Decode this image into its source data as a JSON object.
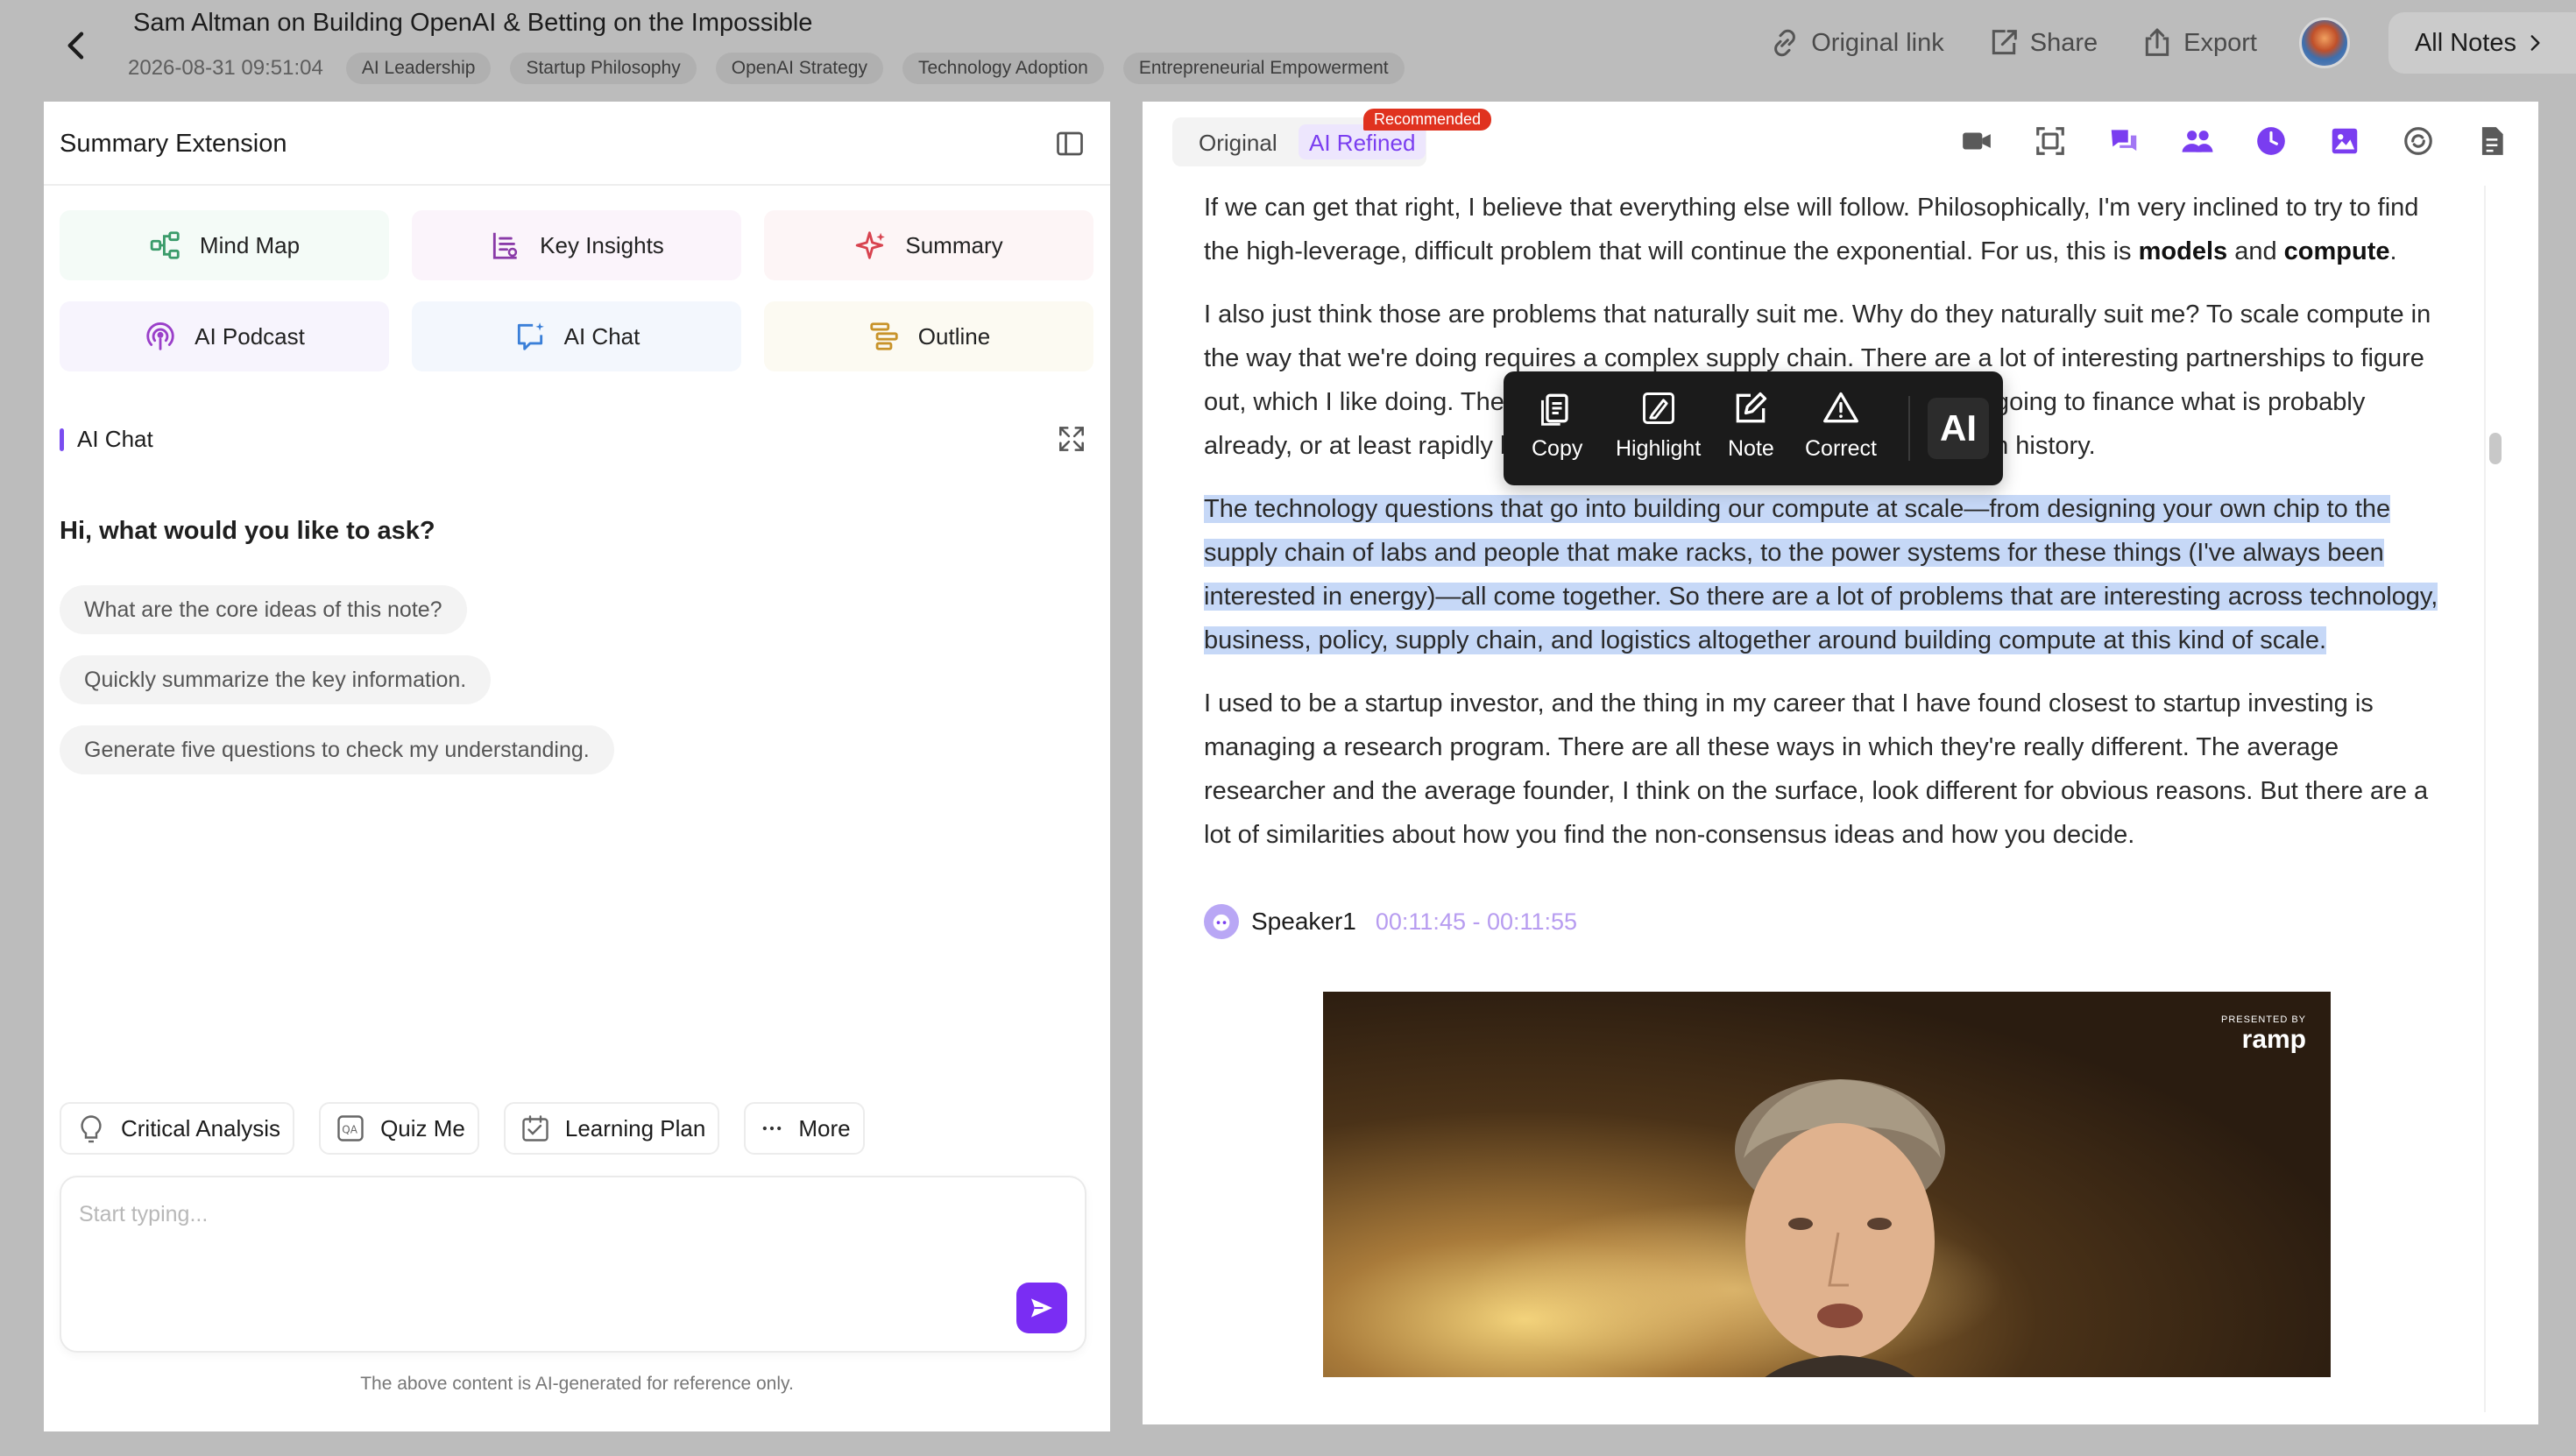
{
  "header": {
    "title": "Sam Altman on Building OpenAI & Betting on the Impossible",
    "date": "2026-08-31 09:51:04",
    "tags": [
      "AI Leadership",
      "Startup Philosophy",
      "OpenAI Strategy",
      "Technology Adoption",
      "Entrepreneurial Empowerment"
    ],
    "actions": {
      "original_link": "Original link",
      "share": "Share",
      "export": "Export",
      "all_notes": "All Notes"
    }
  },
  "left_panel": {
    "title": "Summary Extension",
    "features": [
      "Mind Map",
      "Key Insights",
      "Summary",
      "AI Podcast",
      "AI Chat",
      "Outline"
    ],
    "chat": {
      "section_label": "AI Chat",
      "greeting": "Hi, what would you like to ask?",
      "suggestions": [
        "What are the core ideas of this note?",
        "Quickly summarize the key information.",
        "Generate five questions to check my understanding."
      ],
      "quick_actions": [
        "Critical Analysis",
        "Quiz Me",
        "Learning Plan",
        "More"
      ],
      "input_placeholder": "Start typing...",
      "disclaimer": "The above content is AI-generated for reference only."
    }
  },
  "right_panel": {
    "tabs": {
      "original": "Original",
      "ai_refined": "AI Refined",
      "badge": "Recommended"
    },
    "paragraphs": {
      "p1_text": "If we can get that right, I believe that everything else will follow. Philosophically, I'm very inclined to try to find the high-leverage, difficult problem that will continue the exponential. For us, this is ",
      "p1_bold1": "models",
      "p1_and": " and ",
      "p1_bold2": "compute",
      "p1_end": ".",
      "p2": "I also just think those are problems that naturally suit me. Why do they naturally suit me? To scale compute in the way that we're doing requires a complex supply chain. There are a lot of interesting partnerships to figure out, which I like doing. There are all these questions about how you're going to finance what is probably already, or at least rapidly becoming, the largest infrastructure project in history.",
      "p3_highlighted": "The technology questions that go into building our compute at scale—from designing your own chip to the supply chain of labs and people that make racks, to the power systems for these things (I've always been interested in energy)—all come together. So there are a lot of problems that are interesting across technology, business, policy, supply chain, and logistics altogether around building compute at this kind of scale.",
      "p4": "I used to be a startup investor, and the thing in my career that I have found closest to startup investing is managing a research program. There are all these ways in which they're really different. The average researcher and the average founder, I think on the surface, look different for obvious reasons. But there are a lot of similarities about how you find the non-consensus ideas and how you decide."
    },
    "speaker": {
      "name": "Speaker1",
      "time": "00:11:45 - 00:11:55"
    },
    "video": {
      "presented_by": "PRESENTED BY",
      "brand": "ramp"
    },
    "selection_toolbar": [
      "Copy",
      "Highlight",
      "Note",
      "Correct"
    ],
    "ai_button": "AI"
  }
}
